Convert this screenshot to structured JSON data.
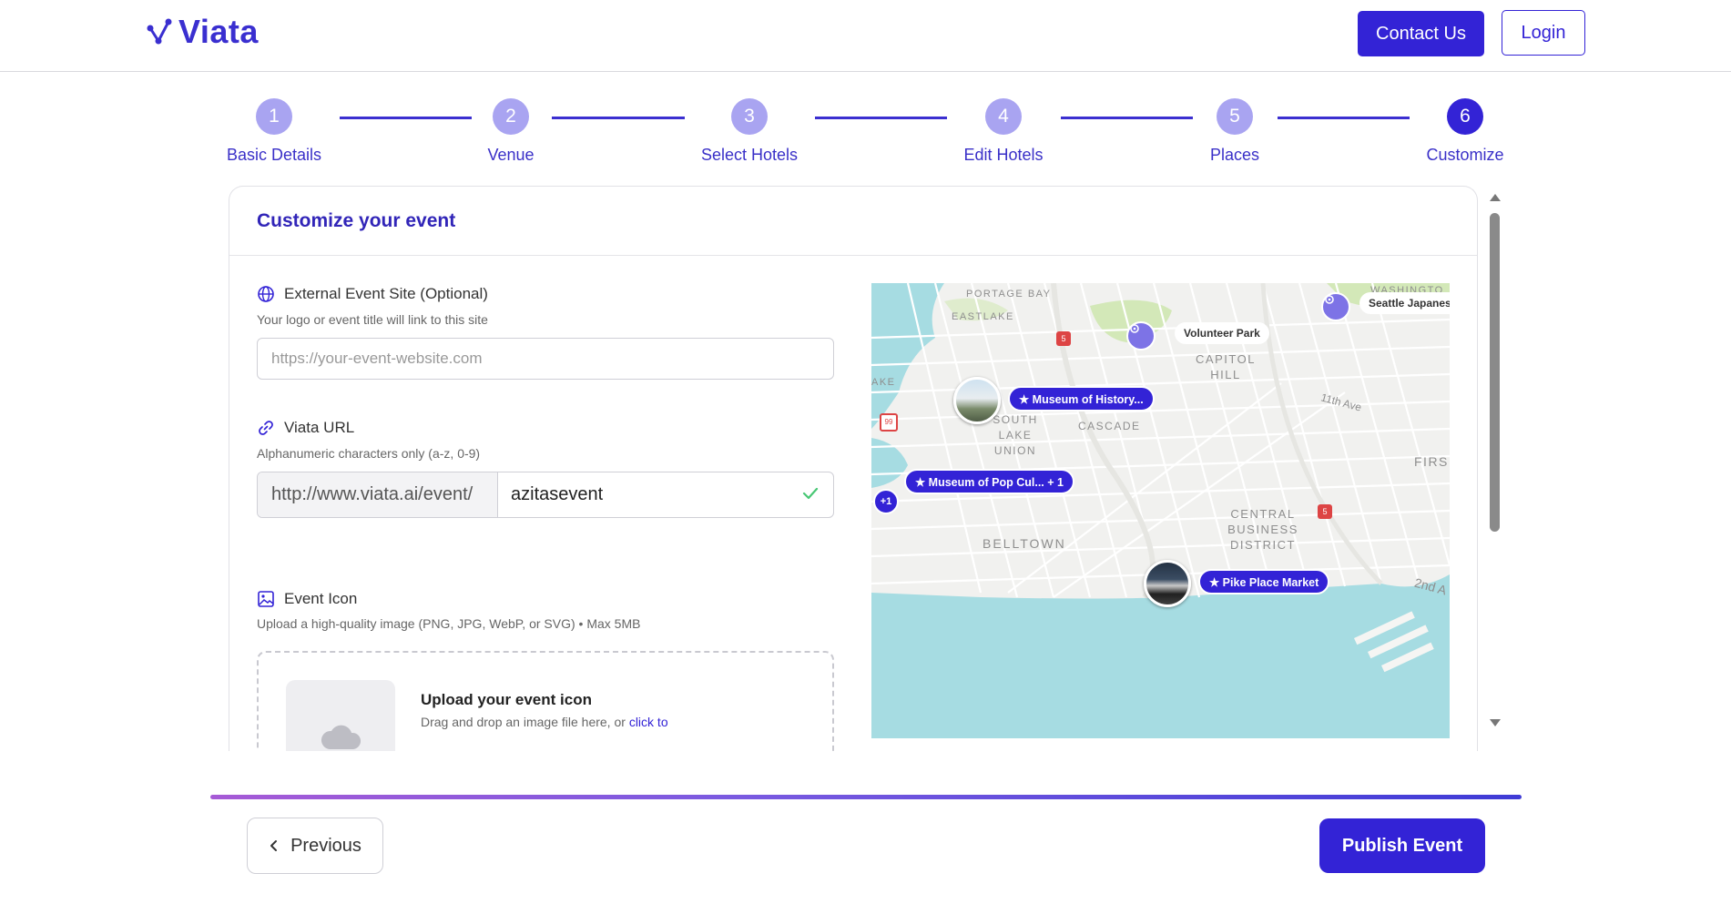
{
  "header": {
    "logo_text": "Viata",
    "contact_label": "Contact Us",
    "login_label": "Login"
  },
  "stepper": {
    "steps": [
      {
        "number": "1",
        "label": "Basic Details"
      },
      {
        "number": "2",
        "label": "Venue"
      },
      {
        "number": "3",
        "label": "Select Hotels"
      },
      {
        "number": "4",
        "label": "Edit Hotels"
      },
      {
        "number": "5",
        "label": "Places"
      },
      {
        "number": "6",
        "label": "Customize"
      }
    ],
    "active_step": 6
  },
  "form": {
    "title": "Customize your event",
    "external_site": {
      "label": "External Event Site (Optional)",
      "help": "Your logo or event title will link to this site",
      "placeholder": "https://your-event-website.com",
      "value": ""
    },
    "viata_url": {
      "label": "Viata URL",
      "help": "Alphanumeric characters only (a-z, 0-9)",
      "prefix": "http://www.viata.ai/event/",
      "value": "azitasevent"
    },
    "event_icon": {
      "label": "Event Icon",
      "help": "Upload a high-quality image (PNG, JPG, WebP, or SVG) • Max 5MB",
      "upload_title": "Upload your event icon",
      "upload_text": "Drag and drop an image file here, or ",
      "upload_link": "click to"
    }
  },
  "map": {
    "markers": [
      {
        "label": "★ Museum of History..."
      },
      {
        "label": "★ Museum of Pop Cul... + 1"
      },
      {
        "label": "★ Pike Place Market"
      }
    ],
    "plus_badge": "+1",
    "places": [
      "Volunteer Park",
      "Seattle Japanes"
    ],
    "districts": [
      "PORTAGE BAY",
      "EASTLAKE",
      "CAPITOL HILL",
      "SOUTH LAKE UNION",
      "CASCADE",
      "CENTRAL BUSINESS DISTRICT",
      "BELLTOWN",
      "FIRS",
      "WASHINGTO",
      "AKE"
    ],
    "streets": [
      "11th Ave",
      "2nd A"
    ],
    "highway_shields": [
      "5",
      "99"
    ]
  },
  "footer": {
    "previous_label": "Previous",
    "publish_label": "Publish Event"
  },
  "colors": {
    "primary": "#3323d6",
    "step_inactive": "#a9a4f1",
    "water": "#a6dce2",
    "park": "#d3e8b8"
  }
}
